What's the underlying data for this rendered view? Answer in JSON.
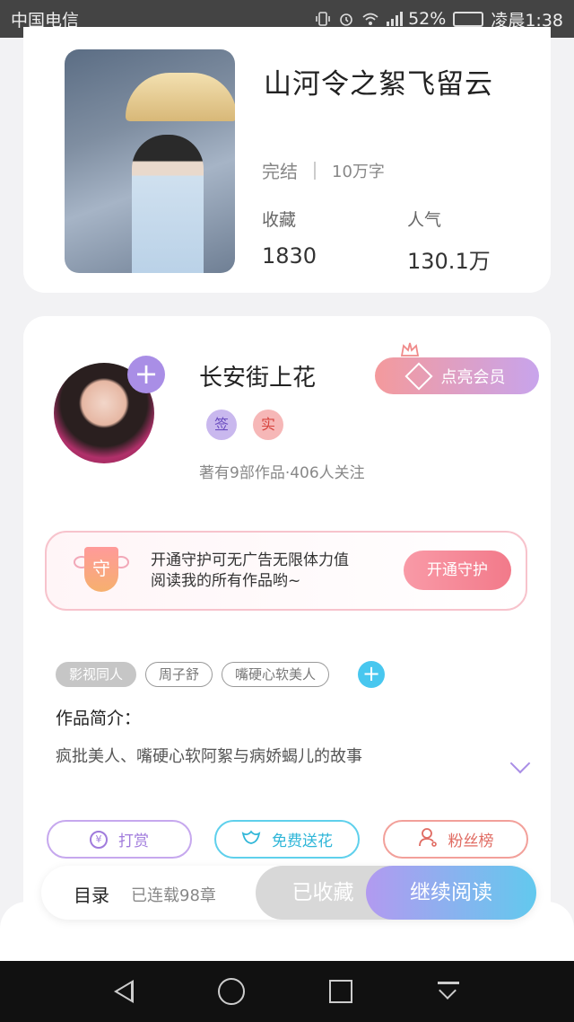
{
  "status_bar": {
    "carrier": "中国电信",
    "battery_percent": "52%",
    "time": "凌晨1:38",
    "battery_level": 0.52
  },
  "book": {
    "title": "山河令之絮飞留云",
    "status": "完结",
    "word_count": "10万字",
    "favorites_label": "收藏",
    "favorites_value": "1830",
    "popularity_label": "人气",
    "popularity_value": "130.1万"
  },
  "author": {
    "name": "长安街上花",
    "badge_signed": "签",
    "badge_verified": "实",
    "stats": "著有9部作品·406人关注",
    "follow_symbol": "+",
    "vip_button": "点亮会员"
  },
  "guard": {
    "shield_char": "守",
    "line1": "开通守护可无广告无限体力值",
    "line2": "阅读我的所有作品哟~",
    "button": "开通守护"
  },
  "tags": {
    "items": [
      "影视同人",
      "周子舒",
      "嘴硬心软美人"
    ],
    "add_symbol": "+"
  },
  "intro": {
    "label": "作品简介：",
    "text": "疯批美人、嘴硬心软阿絮与病娇蝎儿的故事"
  },
  "actions": {
    "reward": "打赏",
    "reward_icon_char": "¥",
    "flower": "免费送花",
    "fans": "粉丝榜"
  },
  "bottom_bar": {
    "toc": "目录",
    "chapters": "已连载98章",
    "collected": "已收藏",
    "continue": "继续阅读"
  },
  "colors": {
    "accent_purple": "#a98ee6",
    "accent_blue": "#62c9ee",
    "accent_pink": "#f27a8a"
  }
}
